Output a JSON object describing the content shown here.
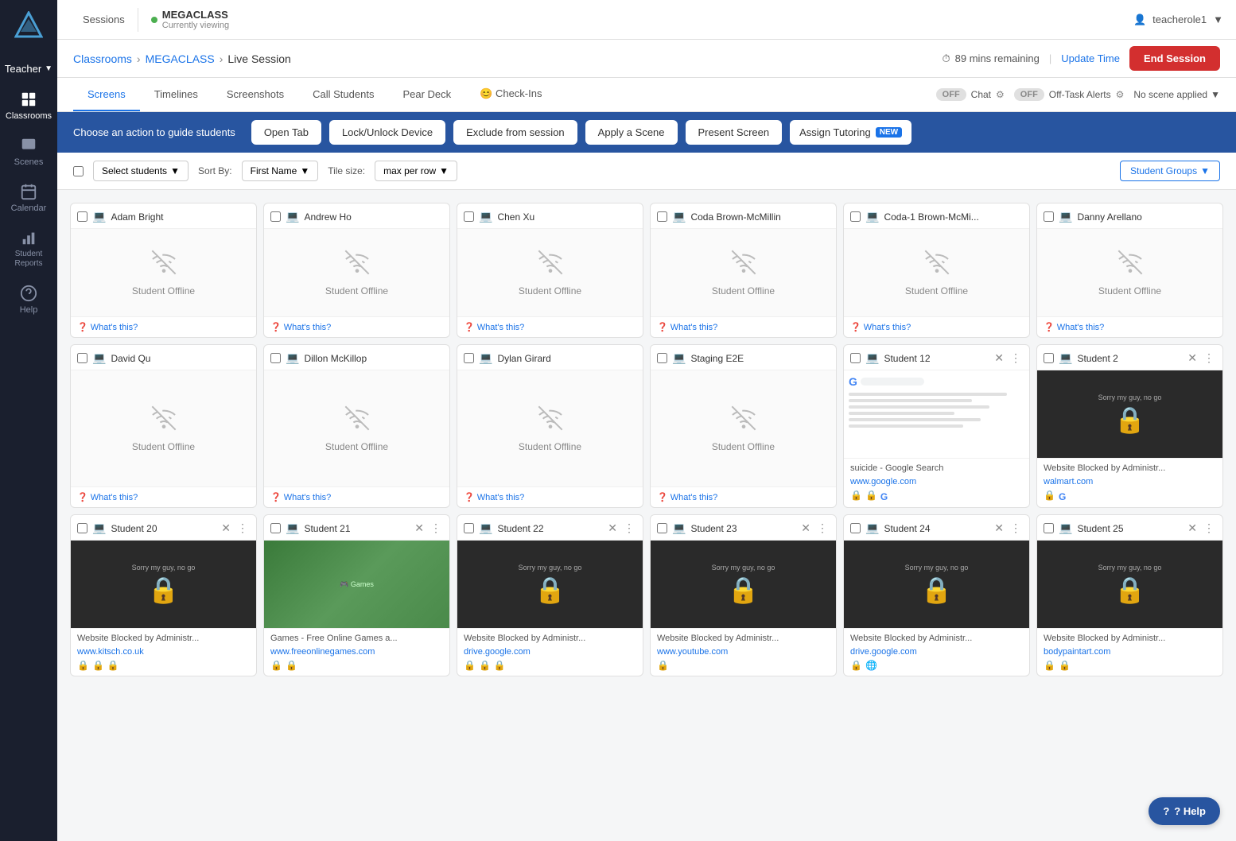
{
  "app": {
    "logo_alt": "Pear Deck logo"
  },
  "sidebar": {
    "teacher_label": "Teacher",
    "items": [
      {
        "id": "classrooms",
        "label": "Classrooms",
        "active": true
      },
      {
        "id": "scenes",
        "label": "Scenes",
        "active": false
      },
      {
        "id": "calendar",
        "label": "Calendar",
        "active": false
      },
      {
        "id": "student-reports",
        "label": "Student Reports",
        "active": false
      },
      {
        "id": "help",
        "label": "Help",
        "active": false
      }
    ]
  },
  "topnav": {
    "sessions_label": "Sessions",
    "class_name": "MEGACLASS",
    "class_status": "Currently viewing",
    "user": "teacherole1"
  },
  "breadcrumb": {
    "classrooms_label": "Classrooms",
    "class_name": "MEGACLASS",
    "page": "Live Session",
    "time_remaining": "89 mins remaining",
    "update_time_label": "Update Time",
    "end_session_label": "End Session"
  },
  "tabs": {
    "items": [
      {
        "id": "screens",
        "label": "Screens",
        "active": true
      },
      {
        "id": "timelines",
        "label": "Timelines",
        "active": false
      },
      {
        "id": "screenshots",
        "label": "Screenshots",
        "active": false
      },
      {
        "id": "call-students",
        "label": "Call Students",
        "active": false
      },
      {
        "id": "pear-deck",
        "label": "Pear Deck",
        "active": false
      },
      {
        "id": "check-ins",
        "label": "😊 Check-Ins",
        "active": false
      }
    ],
    "chat_label": "Chat",
    "chat_toggle": "OFF",
    "off_task_label": "Off-Task Alerts",
    "off_task_toggle": "OFF",
    "scene_label": "No scene applied"
  },
  "action_bar": {
    "guide_text": "Choose an action to guide students",
    "buttons": [
      {
        "id": "open-tab",
        "label": "Open Tab"
      },
      {
        "id": "lock-unlock",
        "label": "Lock/Unlock Device"
      },
      {
        "id": "exclude",
        "label": "Exclude from session"
      },
      {
        "id": "apply-scene",
        "label": "Apply a Scene"
      },
      {
        "id": "present-screen",
        "label": "Present Screen"
      },
      {
        "id": "assign-tutoring",
        "label": "Assign Tutoring",
        "new": true
      }
    ]
  },
  "toolbar": {
    "select_students_label": "Select students",
    "sort_by_label": "Sort By:",
    "sort_value": "First Name",
    "tile_size_label": "Tile size:",
    "tile_size_value": "max per row",
    "groups_label": "Student Groups"
  },
  "students": [
    {
      "name": "Adam Bright",
      "status": "offline",
      "whats_this": "What's this?",
      "type": "offline"
    },
    {
      "name": "Andrew Ho",
      "status": "offline",
      "whats_this": "What's this?",
      "type": "offline"
    },
    {
      "name": "Chen Xu",
      "status": "offline",
      "whats_this": "What's this?",
      "type": "offline"
    },
    {
      "name": "Coda Brown-McMillin",
      "status": "offline",
      "whats_this": "What's this?",
      "type": "offline"
    },
    {
      "name": "Coda-1 Brown-McMi...",
      "status": "offline",
      "whats_this": "What's this?",
      "type": "offline"
    },
    {
      "name": "Danny Arellano",
      "status": "offline",
      "whats_this": "What's this?",
      "type": "offline"
    },
    {
      "name": "David Qu",
      "status": "offline",
      "whats_this": "What's this?",
      "type": "offline"
    },
    {
      "name": "Dillon McKillop",
      "status": "offline",
      "whats_this": "What's this?",
      "type": "offline"
    },
    {
      "name": "Dylan Girard",
      "status": "offline",
      "whats_this": "What's this?",
      "type": "offline"
    },
    {
      "name": "Staging E2E",
      "status": "offline",
      "whats_this": "What's this?",
      "type": "offline"
    },
    {
      "name": "Student 12",
      "type": "blocked",
      "site_title": "suicide - Google Search",
      "site_url": "www.google.com",
      "has_lock": true,
      "has_icons": [
        "🔒",
        "🔒"
      ]
    },
    {
      "name": "Student 2",
      "type": "blocked",
      "site_title": "Website Blocked by Administr...",
      "site_url": "walmart.com",
      "has_lock": true,
      "has_icons": [
        "🔒"
      ]
    },
    {
      "name": "Student 20",
      "type": "blocked",
      "site_title": "Website Blocked by Administr...",
      "site_url": "www.kitsch.co.uk",
      "has_icons": [
        "🔒",
        "🔒",
        "🔒"
      ]
    },
    {
      "name": "Student 21",
      "type": "game",
      "site_title": "Games - Free Online Games a...",
      "site_url": "www.freeonlinegames.com",
      "has_icons": [
        "🔒",
        "🔒"
      ]
    },
    {
      "name": "Student 22",
      "type": "blocked",
      "site_title": "Website Blocked by Administr...",
      "site_url": "drive.google.com",
      "has_icons": [
        "🔒",
        "🔒",
        "🔒"
      ]
    },
    {
      "name": "Student 23",
      "type": "blocked",
      "site_title": "Website Blocked by Administr...",
      "site_url": "www.youtube.com",
      "has_icons": [
        "🔒"
      ]
    },
    {
      "name": "Student 24",
      "type": "blocked",
      "site_title": "Website Blocked by Administr...",
      "site_url": "drive.google.com",
      "has_icons": [
        "🔒",
        "🌐"
      ]
    },
    {
      "name": "Student 25",
      "type": "blocked",
      "site_title": "Website Blocked by Administr...",
      "site_url": "bodypaintart.com",
      "has_icons": [
        "🔒",
        "🔒"
      ]
    }
  ],
  "help_button": "? Help"
}
